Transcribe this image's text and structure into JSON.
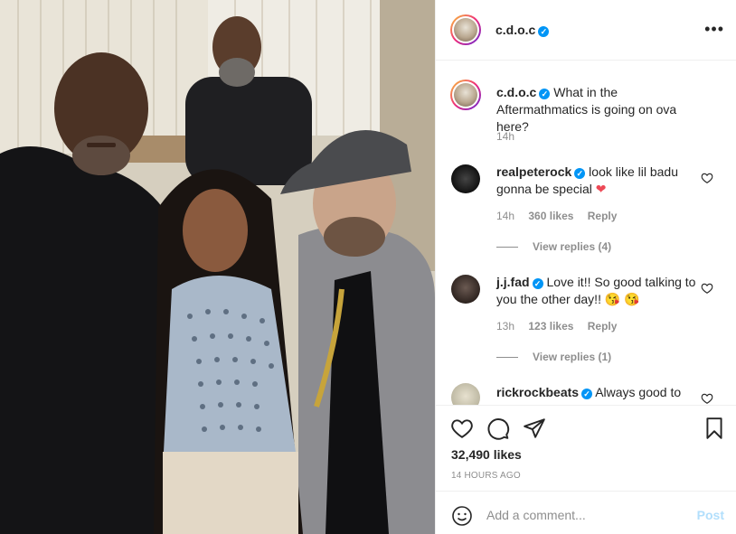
{
  "post": {
    "username": "c.d.o.c",
    "caption": "What in the Aftermathmatics is going on ova here?",
    "caption_time": "14h",
    "likes": "32,490 likes",
    "time_ago": "14 HOURS AGO"
  },
  "comments": [
    {
      "username": "realpeterock",
      "text": "look like lil badu gonna be special",
      "emoji": "❤",
      "time": "14h",
      "likes": "360 likes",
      "reply": "Reply",
      "view_replies": "View replies (4)"
    },
    {
      "username": "j.j.fad",
      "text": "Love it!! So good talking to you the other day!!",
      "emoji": "😘 😘",
      "time": "13h",
      "likes": "123 likes",
      "reply": "Reply",
      "view_replies": "View replies (1)"
    },
    {
      "username": "rickrockbeats",
      "text": "Always good to"
    }
  ],
  "comment_box": {
    "placeholder": "Add a comment...",
    "post_label": "Post"
  },
  "colors": {
    "verified": "#0095f6",
    "heart_emoji": "#ed4956",
    "post_disabled": "#b2dffc"
  },
  "icons": [
    "more-icon",
    "heart-icon",
    "comment-icon",
    "share-icon",
    "bookmark-icon",
    "emoji-icon",
    "verified-icon"
  ]
}
